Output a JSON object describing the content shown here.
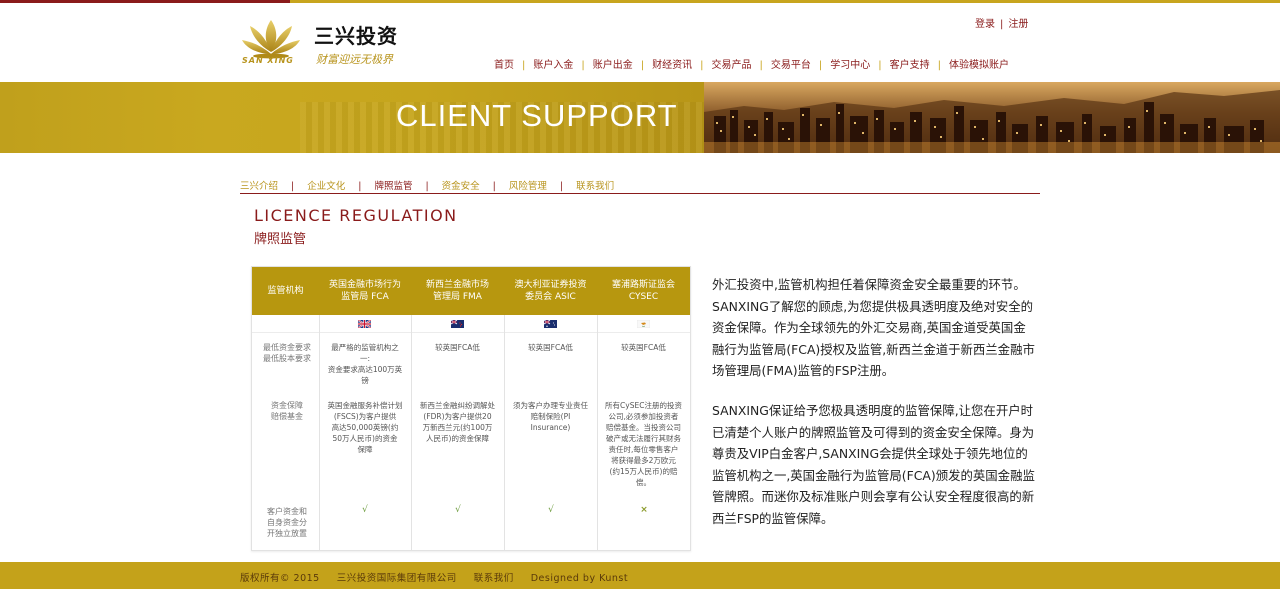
{
  "colors": {
    "gold": "#c4a21a",
    "maroon": "#8a1b1b"
  },
  "header": {
    "logo_text": "三兴投资",
    "logo_en": "SAN XING",
    "logo_slogan": "财富迎远无极界",
    "auth": {
      "login": "登录",
      "separator": "|",
      "register": "注册"
    },
    "nav": [
      {
        "label": "首页"
      },
      {
        "label": "账户入金"
      },
      {
        "label": "账户出金"
      },
      {
        "label": "财经资讯"
      },
      {
        "label": "交易产品"
      },
      {
        "label": "交易平台"
      },
      {
        "label": "学习中心"
      },
      {
        "label": "客户支持"
      },
      {
        "label": "体验模拟账户"
      }
    ]
  },
  "banner": {
    "title": "CLIENT SUPPORT"
  },
  "subnav": [
    {
      "label": "三兴介绍"
    },
    {
      "label": "企业文化"
    },
    {
      "label": "牌照监管",
      "active": true
    },
    {
      "label": "资金安全"
    },
    {
      "label": "风险管理"
    },
    {
      "label": "联系我们"
    }
  ],
  "section": {
    "title_en": "LICENCE REGULATION",
    "title_cn": "牌照监管"
  },
  "table": {
    "headers": [
      {
        "line1": "监管机构",
        "line2": ""
      },
      {
        "line1": "英国金融市场行为",
        "line2": "监管局 FCA"
      },
      {
        "line1": "新西兰金融市场",
        "line2": "管理局 FMA"
      },
      {
        "line1": "澳大利亚证券投资",
        "line2": "委员会 ASIC"
      },
      {
        "line1": "塞浦路斯证监会",
        "line2": "CYSEC"
      }
    ],
    "flags": [
      "uk-flag-icon",
      "nz-flag-icon",
      "au-flag-icon",
      "cy-flag-icon"
    ],
    "rows": [
      {
        "label": [
          "最低资金要求",
          "最低股本要求"
        ],
        "cells": [
          [
            "最严格的监管机构之",
            "一:",
            "资金要求高达100万英",
            "镑"
          ],
          [
            "较英国FCA低"
          ],
          [
            "较英国FCA低"
          ],
          [
            "较英国FCA低"
          ]
        ]
      },
      {
        "label": [
          "资金保障",
          "赔偿基金"
        ],
        "cells": [
          [
            "英国金融服务补偿计划",
            "(FSCS)为客户提供",
            "高达50,000英镑(约",
            "50万人民币)的资金",
            "保障"
          ],
          [
            "新西兰金融纠纷调解处",
            "(FDR)为客户提供20",
            "万新西兰元(约100万",
            "人民币)的资金保障"
          ],
          [
            "须为客户办理专业责任",
            "赔制保险(PI",
            "Insurance)"
          ],
          [
            "所有CySEC注册的投资",
            "公司,必须参加投资者",
            "赔偿基金。当投资公司",
            "破产或无法履行其财务",
            "责任时,每位零售客户",
            "将获得最多2万欧元",
            "(约15万人民币)的赔",
            "偿。"
          ]
        ]
      },
      {
        "label": [
          "客户资金和",
          "自身资金分",
          "开独立放置"
        ],
        "marks": [
          "√",
          "√",
          "√",
          "×"
        ]
      }
    ]
  },
  "paragraphs": [
    "外汇投资中,监管机构担任着保障资金安全最重要的环节。SANXING了解您的顾虑,为您提供极具透明度及绝对安全的资金保障。作为全球领先的外汇交易商,英国金道受英国金融行为监管局(FCA)授权及监管,新西兰金道于新西兰金融市场管理局(FMA)监管的FSP注册。",
    "SANXING保证给予您极具透明度的监管保障,让您在开户时已清楚个人账户的牌照监管及可得到的资金安全保障。身为尊贵及VIP白金客户,SANXING会提供全球处于领先地位的监管机构之一,英国金融行为监管局(FCA)颁发的英国金融监管牌照。而迷你及标准账户则会享有公认安全程度很高的新西兰FSP的监管保障。"
  ],
  "footer": {
    "copyright": "版权所有©  2015",
    "company": "三兴投资国际集团有限公司",
    "contact": "联系我们",
    "designed": "Designed by Kunst"
  }
}
